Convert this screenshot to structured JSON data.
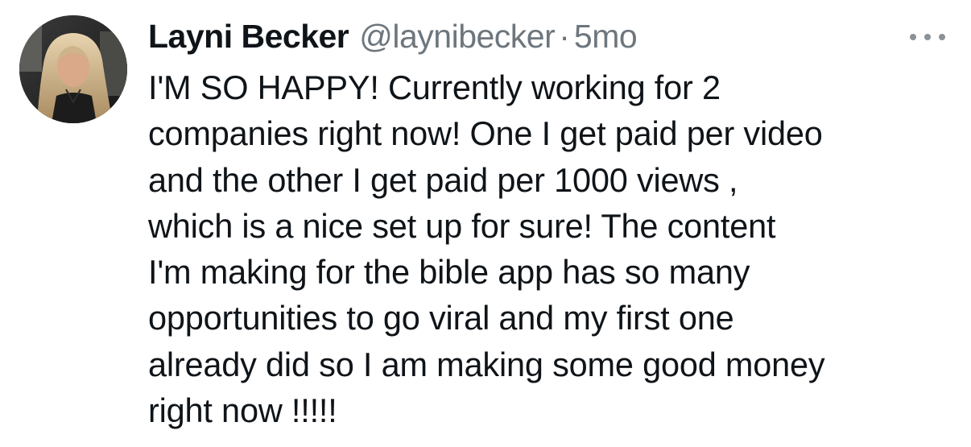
{
  "tweet": {
    "author_name": "Layni Becker",
    "author_handle": "@laynibecker",
    "separator": "·",
    "time_ago": "5mo",
    "more_icon": "ellipsis-icon",
    "avatar_icon": "profile-photo",
    "text": "I'M SO HAPPY! Currently working for 2\ncompanies right now! One I get paid per video\nand the other I get paid per 1000 views ,\nwhich is a nice set up for sure! The content\nI'm making for the bible app has so many\nopportunities to go viral and my first one\nalready did so I am making some good money\nright now !!!!!"
  },
  "colors": {
    "text": "#0f1419",
    "secondary": "#6e767d",
    "background": "#ffffff"
  }
}
